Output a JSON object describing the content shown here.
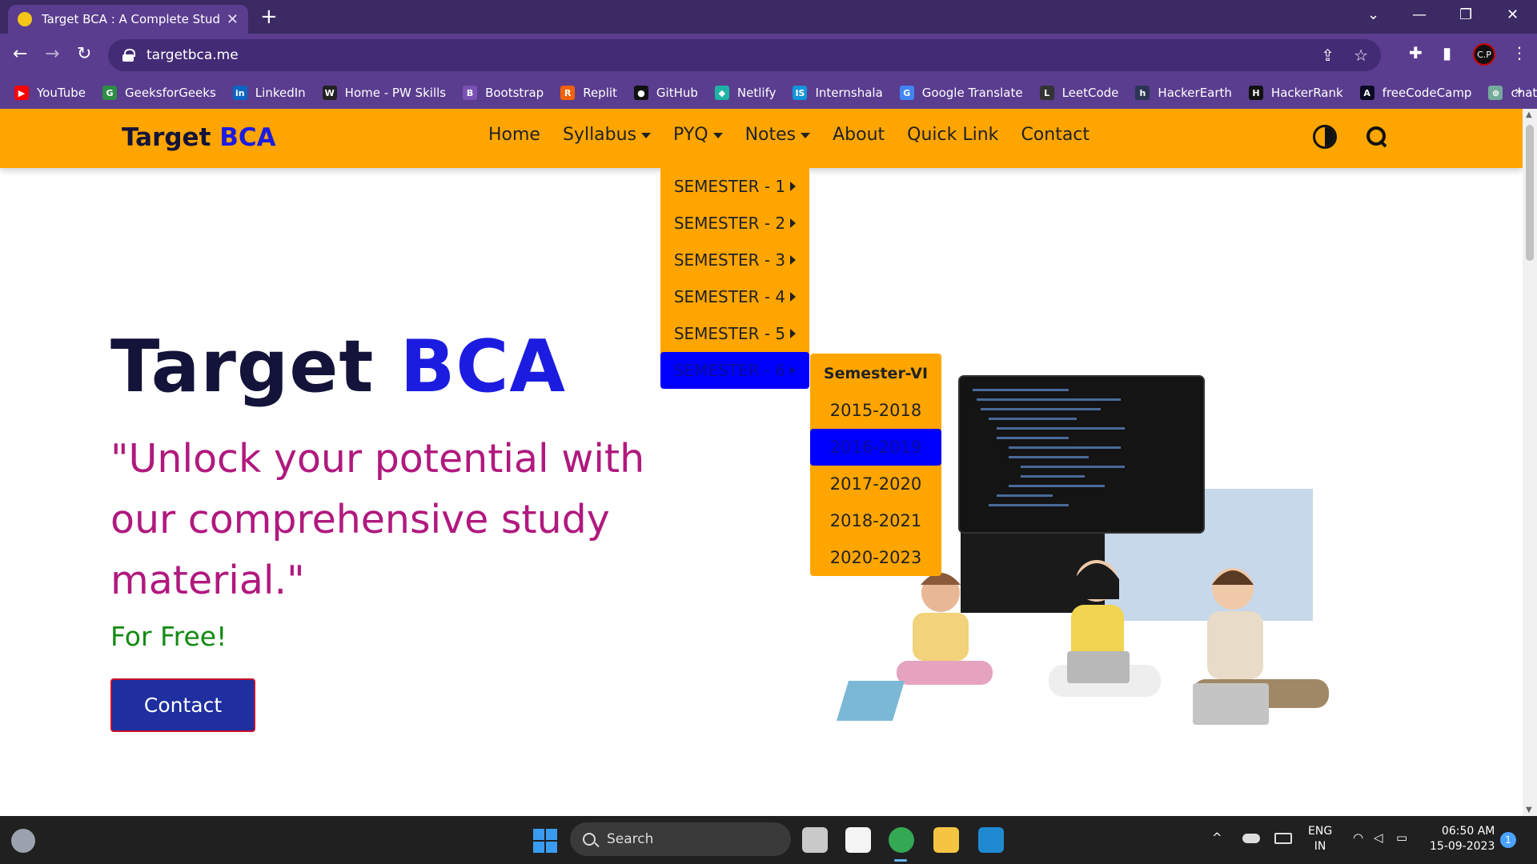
{
  "browser": {
    "tab": {
      "title": "Target BCA : A Complete Study P",
      "close": "✕"
    },
    "new_tab": "+",
    "window_controls": {
      "chevron": "⌄",
      "minimize": "—",
      "restore": "❐",
      "close": "✕"
    },
    "nav": {
      "back": "←",
      "forward": "→",
      "reload": "↻"
    },
    "address": "targetbca.me",
    "omnibox_icons": {
      "share": "⇪",
      "star": "☆"
    },
    "toolbar_icons": {
      "extensions": "✚",
      "sidepanel": "▮",
      "menu": "⋮"
    },
    "profile_initials": "C.P",
    "bookmarks": [
      {
        "label": "YouTube",
        "icon": "youtube-icon",
        "color": "#ff0000",
        "glyph": "▶"
      },
      {
        "label": "GeeksforGeeks",
        "icon": "geeksforgeeks-icon",
        "color": "#2f8d46",
        "glyph": "G"
      },
      {
        "label": "LinkedIn",
        "icon": "linkedin-icon",
        "color": "#0a66c2",
        "glyph": "in"
      },
      {
        "label": "Home - PW Skills",
        "icon": "pwskills-icon",
        "color": "#222222",
        "glyph": "W"
      },
      {
        "label": "Bootstrap",
        "icon": "bootstrap-icon",
        "color": "#7952b3",
        "glyph": "B"
      },
      {
        "label": "Replit",
        "icon": "replit-icon",
        "color": "#f26207",
        "glyph": "R"
      },
      {
        "label": "GitHub",
        "icon": "github-icon",
        "color": "#111111",
        "glyph": "●"
      },
      {
        "label": "Netlify",
        "icon": "netlify-icon",
        "color": "#1fb3a6",
        "glyph": "◆"
      },
      {
        "label": "Internshala",
        "icon": "internshala-icon",
        "color": "#1295d8",
        "glyph": "IS"
      },
      {
        "label": "Google Translate",
        "icon": "google-translate-icon",
        "color": "#4285f4",
        "glyph": "G"
      },
      {
        "label": "LeetCode",
        "icon": "leetcode-icon",
        "color": "#333333",
        "glyph": "L"
      },
      {
        "label": "HackerEarth",
        "icon": "hackerearth-icon",
        "color": "#2c3454",
        "glyph": "h"
      },
      {
        "label": "HackerRank",
        "icon": "hackerrank-icon",
        "color": "#111111",
        "glyph": "H"
      },
      {
        "label": "freeCodeCamp",
        "icon": "freecodecamp-icon",
        "color": "#0a0a23",
        "glyph": "A"
      },
      {
        "label": "chat gpt",
        "icon": "chatgpt-icon",
        "color": "#74aa9c",
        "glyph": "⊛"
      }
    ],
    "bookmarks_more": "»"
  },
  "site": {
    "brand": {
      "part1": "Target",
      "part2": "BCA"
    },
    "nav": {
      "home": "Home",
      "syllabus": "Syllabus",
      "pyq": "PYQ",
      "notes": "Notes",
      "about": "About",
      "quick_link": "Quick Link",
      "contact": "Contact"
    },
    "pyq_menu": [
      "SEMESTER - 1",
      "SEMESTER - 2",
      "SEMESTER - 3",
      "SEMESTER - 4",
      "SEMESTER - 5",
      "SEMESTER - 6"
    ],
    "sem6_menu": {
      "heading": "Semester-VI",
      "items": [
        "2015-2018",
        "2016-2019",
        "2017-2020",
        "2018-2021",
        "2020-2023"
      ]
    },
    "hero": {
      "title1": "Target",
      "title2": "BCA",
      "quote": "\"Unlock your potential with our comprehensive study material.\"",
      "free": "For Free!",
      "button": "Contact"
    },
    "colors": {
      "nav_bg": "#ffa500",
      "accent_blue": "#1c1ce0",
      "quote": "#b0197e",
      "free": "#138a13",
      "button": "#1f2f9f",
      "active_item": "#0000ff"
    }
  },
  "taskbar": {
    "search": "Search",
    "lang1": "ENG",
    "lang2": "IN",
    "time": "06:50 AM",
    "date": "15-09-2023",
    "notifications": "1",
    "tray": {
      "chevron": "^",
      "wifi": "◠",
      "volume": "◁",
      "battery": "▭"
    }
  }
}
